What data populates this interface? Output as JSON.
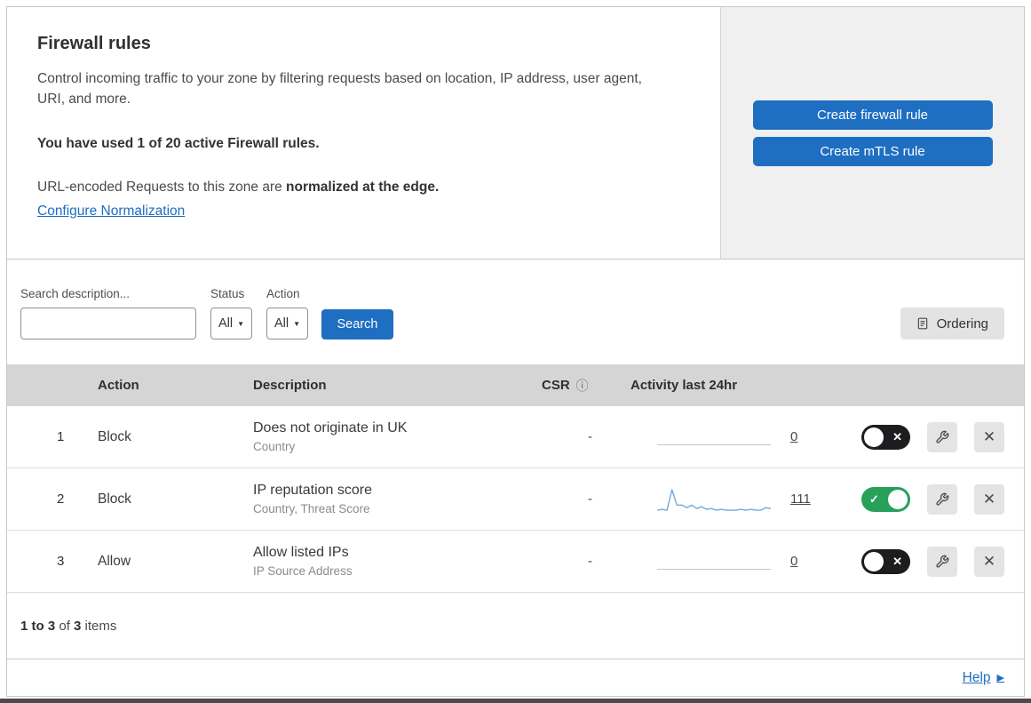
{
  "header": {
    "title": "Firewall rules",
    "description": "Control incoming traffic to your zone by filtering requests based on location, IP address, user agent, URI, and more.",
    "usage": "You have used 1 of 20 active Firewall rules.",
    "normalization": {
      "prefix": "URL-encoded Requests to this zone are ",
      "bold": "normalized at the edge.",
      "link": "Configure Normalization"
    },
    "actions": {
      "create_firewall_rule": "Create firewall rule",
      "create_mtls_rule": "Create mTLS rule"
    }
  },
  "filters": {
    "search_label": "Search description...",
    "status": {
      "label": "Status",
      "value": "All"
    },
    "action": {
      "label": "Action",
      "value": "All"
    },
    "search_button": "Search",
    "ordering_button": "Ordering"
  },
  "table": {
    "headers": {
      "action": "Action",
      "description": "Description",
      "csr": "CSR",
      "activity": "Activity last 24hr"
    },
    "rows": [
      {
        "num": "1",
        "action": "Block",
        "title": "Does not originate in UK",
        "subtitle": "Country",
        "csr": "-",
        "count": "0",
        "enabled": false
      },
      {
        "num": "2",
        "action": "Block",
        "title": "IP reputation score",
        "subtitle": "Country, Threat Score",
        "csr": "-",
        "count": "111",
        "enabled": true
      },
      {
        "num": "3",
        "action": "Allow",
        "title": "Allow listed IPs",
        "subtitle": "IP Source Address",
        "csr": "-",
        "count": "0",
        "enabled": false
      }
    ]
  },
  "chart_data": {
    "type": "line",
    "context": "activity-sparkline-row-2",
    "title": "Activity last 24hr",
    "total": 111,
    "values": [
      2,
      3,
      2,
      26,
      8,
      8,
      5,
      8,
      4,
      6,
      3,
      4,
      2,
      3,
      2,
      2,
      2,
      3,
      2,
      3,
      2,
      2,
      5,
      4
    ]
  },
  "footer": {
    "range": "1 to 3",
    "of": " of ",
    "total": "3",
    "items": " items"
  },
  "help": {
    "label": "Help"
  },
  "icons": {
    "dropdown_caret": "▼",
    "info": "ⓘ",
    "toggle_on_check": "✓",
    "toggle_off_x": "✕",
    "close_x": "✕",
    "help_arrow": "▶"
  },
  "colors": {
    "primary_blue": "#1e6ec2",
    "toggle_on_green": "#27a05a",
    "toggle_off_black": "#1d1d1f",
    "sparkline": "#76a9d8",
    "table_header_bg": "#d5d5d5",
    "panel_bg": "#f0f0f0"
  }
}
